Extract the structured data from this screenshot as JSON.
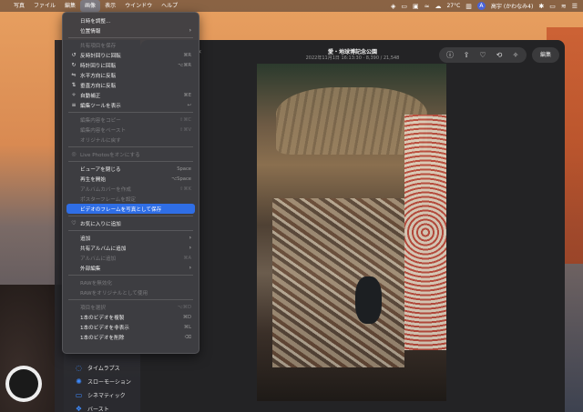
{
  "menubar": {
    "items": [
      "写真",
      "ファイル",
      "編集",
      "画像",
      "表示",
      "ウインドウ",
      "ヘルプ"
    ],
    "active_index": 3,
    "right": {
      "temp": "27°C",
      "user": "高宇 (かわなみ4)",
      "user_initial": "A"
    }
  },
  "window": {
    "title": "愛・地球博記念公園",
    "subtitle": "2022年11月1日 16:13:30 · 8,390 / 21,548",
    "edit_label": "編集"
  },
  "menu": {
    "rows": [
      {
        "label": "日時を調整...",
        "shortcut": "",
        "icon": "",
        "disabled": false
      },
      {
        "label": "位置情報",
        "shortcut": "",
        "icon": "",
        "disabled": false,
        "submenu": true
      },
      {
        "sep": true
      },
      {
        "label": "共有項目を保存",
        "shortcut": "",
        "icon": "",
        "disabled": true
      },
      {
        "label": "反時計回りに回転",
        "shortcut": "⌘R",
        "icon": "↺",
        "disabled": false
      },
      {
        "label": "時計回りに回転",
        "shortcut": "⌥⌘R",
        "icon": "↻",
        "disabled": false
      },
      {
        "label": "水平方向に反転",
        "shortcut": "",
        "icon": "⇋",
        "disabled": false
      },
      {
        "label": "垂直方向に反転",
        "shortcut": "",
        "icon": "⇅",
        "disabled": false
      },
      {
        "label": "自動補正",
        "shortcut": "⌘E",
        "icon": "✧",
        "disabled": false
      },
      {
        "label": "編集ツールを表示",
        "shortcut": "↩",
        "icon": "≡",
        "disabled": false
      },
      {
        "sep": true
      },
      {
        "label": "編集内容をコピー",
        "shortcut": "⇧⌘C",
        "icon": "",
        "disabled": true
      },
      {
        "label": "編集内容をペースト",
        "shortcut": "⇧⌘V",
        "icon": "",
        "disabled": true
      },
      {
        "label": "オリジナルに戻す",
        "shortcut": "",
        "icon": "",
        "disabled": true
      },
      {
        "sep": true
      },
      {
        "label": "Live Photosをオンにする",
        "shortcut": "",
        "icon": "◎",
        "disabled": true
      },
      {
        "sep": true
      },
      {
        "label": "ビューアを閉じる",
        "shortcut": "Space",
        "icon": "",
        "disabled": false
      },
      {
        "label": "再生を開始",
        "shortcut": "⌥Space",
        "icon": "",
        "disabled": false
      },
      {
        "label": "アルバムカバーを作成",
        "shortcut": "⇧⌘K",
        "icon": "",
        "disabled": true
      },
      {
        "label": "ポスターフレームを設定",
        "shortcut": "",
        "icon": "",
        "disabled": true
      },
      {
        "label": "ビデオのフレームを写真として保存",
        "shortcut": "",
        "icon": "",
        "disabled": false,
        "highlight": true
      },
      {
        "sep": true
      },
      {
        "label": "お気に入りに追加",
        "shortcut": "",
        "icon": "♡",
        "disabled": false
      },
      {
        "sep": true
      },
      {
        "label": "追加",
        "shortcut": "",
        "icon": "",
        "disabled": false,
        "submenu": true
      },
      {
        "label": "共有アルバムに追加",
        "shortcut": "",
        "icon": "",
        "disabled": false,
        "submenu": true
      },
      {
        "label": "アルバムに追加",
        "shortcut": "⌘A",
        "icon": "",
        "disabled": true
      },
      {
        "label": "外部編集",
        "shortcut": "",
        "icon": "",
        "disabled": false,
        "submenu": true
      },
      {
        "sep": true
      },
      {
        "label": "RAWを無効化",
        "shortcut": "",
        "icon": "",
        "disabled": true
      },
      {
        "label": "RAWをオリジナルとして使用",
        "shortcut": "",
        "icon": "",
        "disabled": true
      },
      {
        "sep": true
      },
      {
        "label": "項目を選択",
        "shortcut": "⌥⌘D",
        "icon": "",
        "disabled": true
      },
      {
        "label": "1本のビデオを複製",
        "shortcut": "⌘D",
        "icon": "",
        "disabled": false
      },
      {
        "label": "1本のビデオを非表示",
        "shortcut": "⌘L",
        "icon": "",
        "disabled": false
      },
      {
        "label": "1本のビデオを削除",
        "shortcut": "⌫",
        "icon": "",
        "disabled": false
      }
    ]
  },
  "sidebar": {
    "items": [
      {
        "label": "タイムラプス",
        "icon": "◌"
      },
      {
        "label": "スローモーション",
        "icon": "✺"
      },
      {
        "label": "シネマティック",
        "icon": "▭"
      },
      {
        "label": "バースト",
        "icon": "❖"
      }
    ]
  }
}
